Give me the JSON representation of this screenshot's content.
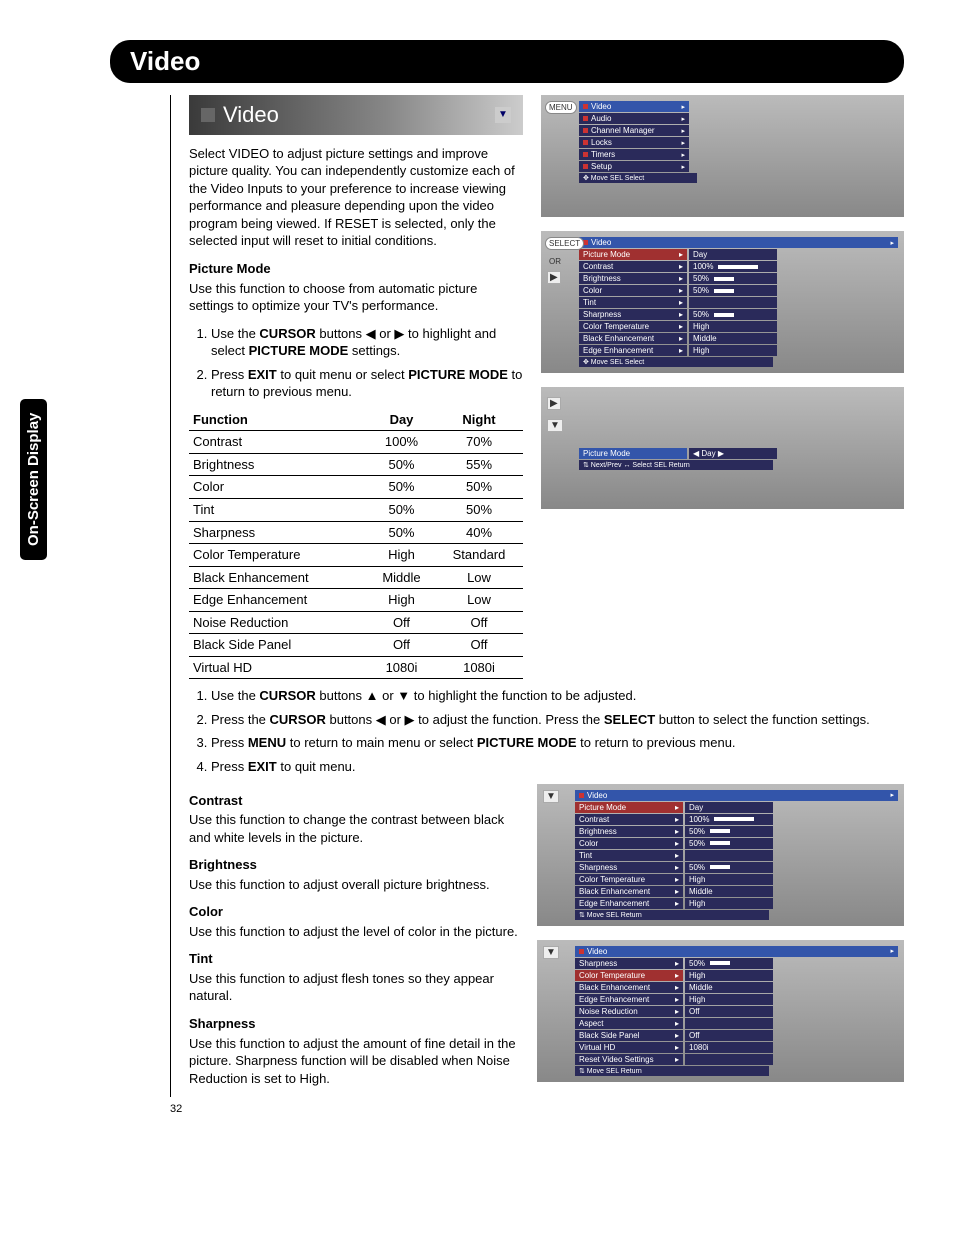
{
  "page_number": "32",
  "side_tab": "On-Screen Display",
  "header": "Video",
  "video_subheader": "Video",
  "intro": "Select VIDEO to adjust picture settings and improve picture quality. You can independently customize each of the Video Inputs to your preference to increase viewing performance and pleasure depending upon the video program being viewed. If RESET is selected, only the selected input will reset to initial conditions.",
  "picture_mode": {
    "title": "Picture Mode",
    "desc": "Use this function to choose from automatic picture settings to optimize your TV's performance.",
    "step1_a": "Use the ",
    "step1_b": "CURSOR",
    "step1_c": " buttons ◀ or ▶ to highlight and select ",
    "step1_d": "PICTURE MODE",
    "step1_e": " settings.",
    "step2_a": "Press ",
    "step2_b": "EXIT",
    "step2_c": " to quit menu or select ",
    "step2_d": "PICTURE MODE",
    "step2_e": " to return to previous menu."
  },
  "table": {
    "h1": "Function",
    "h2": "Day",
    "h3": "Night",
    "rows": [
      {
        "f": "Contrast",
        "d": "100%",
        "n": "70%"
      },
      {
        "f": "Brightness",
        "d": "50%",
        "n": "55%"
      },
      {
        "f": "Color",
        "d": "50%",
        "n": "50%"
      },
      {
        "f": "Tint",
        "d": "50%",
        "n": "50%"
      },
      {
        "f": "Sharpness",
        "d": "50%",
        "n": "40%"
      },
      {
        "f": "Color Temperature",
        "d": "High",
        "n": "Standard"
      },
      {
        "f": "Black Enhancement",
        "d": "Middle",
        "n": "Low"
      },
      {
        "f": "Edge Enhancement",
        "d": "High",
        "n": "Low"
      },
      {
        "f": "Noise Reduction",
        "d": "Off",
        "n": "Off"
      },
      {
        "f": "Black Side Panel",
        "d": "Off",
        "n": "Off"
      },
      {
        "f": "Virtual HD",
        "d": "1080i",
        "n": "1080i"
      }
    ]
  },
  "steps2": {
    "s1a": "Use the ",
    "s1b": "CURSOR",
    "s1c": " buttons ▲ or ▼ to highlight the function to be adjusted.",
    "s2a": "Press the ",
    "s2b": "CURSOR",
    "s2c": " buttons ◀ or ▶ to adjust the function. Press the ",
    "s2d": "SELECT",
    "s2e": " button to select the function settings.",
    "s3a": "Press ",
    "s3b": "MENU",
    "s3c": " to return to main menu or select ",
    "s3d": "PICTURE MODE",
    "s3e": " to return to previous menu.",
    "s4a": "Press ",
    "s4b": "EXIT",
    "s4c": " to quit menu."
  },
  "sections": [
    {
      "t": "Contrast",
      "d": "Use this function to change the contrast between black and white levels in the picture."
    },
    {
      "t": "Brightness",
      "d": "Use this function to adjust overall picture brightness."
    },
    {
      "t": "Color",
      "d": "Use this function to adjust the level of color in the picture."
    },
    {
      "t": "Tint",
      "d": "Use this function to adjust flesh tones so they appear natural."
    },
    {
      "t": "Sharpness",
      "d": "Use this function to adjust the amount of fine detail in the picture. Sharpness function will be disabled when Noise Reduction is set to High."
    }
  ],
  "osd1": {
    "remote": "MENU",
    "items": [
      "Video",
      "Audio",
      "Channel Manager",
      "Locks",
      "Timers",
      "Setup"
    ],
    "hint": "✥ Move    SEL Select"
  },
  "osd2": {
    "remote": "SELECT",
    "or": "OR",
    "head": "Video",
    "rows": [
      {
        "l": "Picture Mode",
        "v": "Day"
      },
      {
        "l": "Contrast",
        "v": "100%"
      },
      {
        "l": "Brightness",
        "v": "50%"
      },
      {
        "l": "Color",
        "v": "50%"
      },
      {
        "l": "Tint",
        "v": ""
      },
      {
        "l": "Sharpness",
        "v": "50%"
      },
      {
        "l": "Color Temperature",
        "v": "High"
      },
      {
        "l": "Black Enhancement",
        "v": "Middle"
      },
      {
        "l": "Edge Enhancement",
        "v": "High"
      }
    ],
    "hint": "✥ Move    SEL Select"
  },
  "osd3": {
    "row": {
      "l": "Picture Mode",
      "v": "◀ Day ▶"
    },
    "hint": "⇅ Next/Prev  ↔ Select    SEL Return"
  },
  "osd4": {
    "head": "Video",
    "rows": [
      {
        "l": "Picture Mode",
        "v": "Day"
      },
      {
        "l": "Contrast",
        "v": "100%"
      },
      {
        "l": "Brightness",
        "v": "50%"
      },
      {
        "l": "Color",
        "v": "50%"
      },
      {
        "l": "Tint",
        "v": ""
      },
      {
        "l": "Sharpness",
        "v": "50%"
      },
      {
        "l": "Color Temperature",
        "v": "High"
      },
      {
        "l": "Black Enhancement",
        "v": "Middle"
      },
      {
        "l": "Edge Enhancement",
        "v": "High"
      }
    ],
    "hint": "⇅ Move    SEL Return"
  },
  "osd5": {
    "head": "Video",
    "rows": [
      {
        "l": "Sharpness",
        "v": "50%"
      },
      {
        "l": "Color Temperature",
        "v": "High"
      },
      {
        "l": "Black Enhancement",
        "v": "Middle"
      },
      {
        "l": "Edge Enhancement",
        "v": "High"
      },
      {
        "l": "Noise Reduction",
        "v": "Off"
      },
      {
        "l": "Aspect",
        "v": ""
      },
      {
        "l": "Black Side Panel",
        "v": "Off"
      },
      {
        "l": "Virtual HD",
        "v": "1080i"
      },
      {
        "l": "Reset Video Settings",
        "v": ""
      }
    ],
    "hint": "⇅ Move    SEL Return"
  }
}
